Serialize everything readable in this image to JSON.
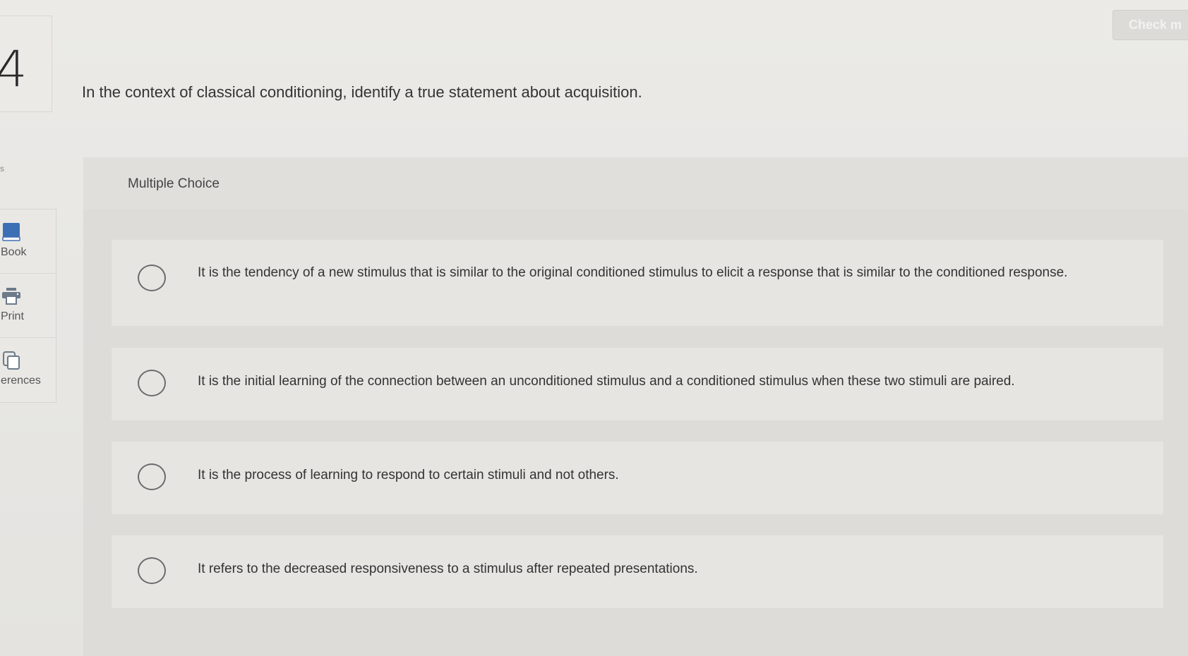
{
  "question_number": "4",
  "sidebar": {
    "tick": "s",
    "tools": [
      {
        "label": "Book",
        "icon": "book-icon"
      },
      {
        "label": "Print",
        "icon": "printer-icon"
      },
      {
        "label": "erences",
        "icon": "references-icon"
      }
    ]
  },
  "toolbar": {
    "check_label": "Check m"
  },
  "question": {
    "prompt": "In the context of classical conditioning, identify a true statement about acquisition.",
    "type_label": "Multiple Choice",
    "options": [
      {
        "text": "It is the tendency of a new stimulus that is similar to the original conditioned stimulus to elicit a response that is similar to the conditioned response."
      },
      {
        "text": "It is the initial learning of the connection between an unconditioned stimulus and a conditioned stimulus when these two stimuli are paired."
      },
      {
        "text": "It is the process of learning to respond to certain stimuli and not others."
      },
      {
        "text": "It refers to the decreased responsiveness to a stimulus after repeated presentations."
      }
    ]
  },
  "colors": {
    "book_blue": "#3d6fb4",
    "icon_gray": "#6c7a89"
  }
}
